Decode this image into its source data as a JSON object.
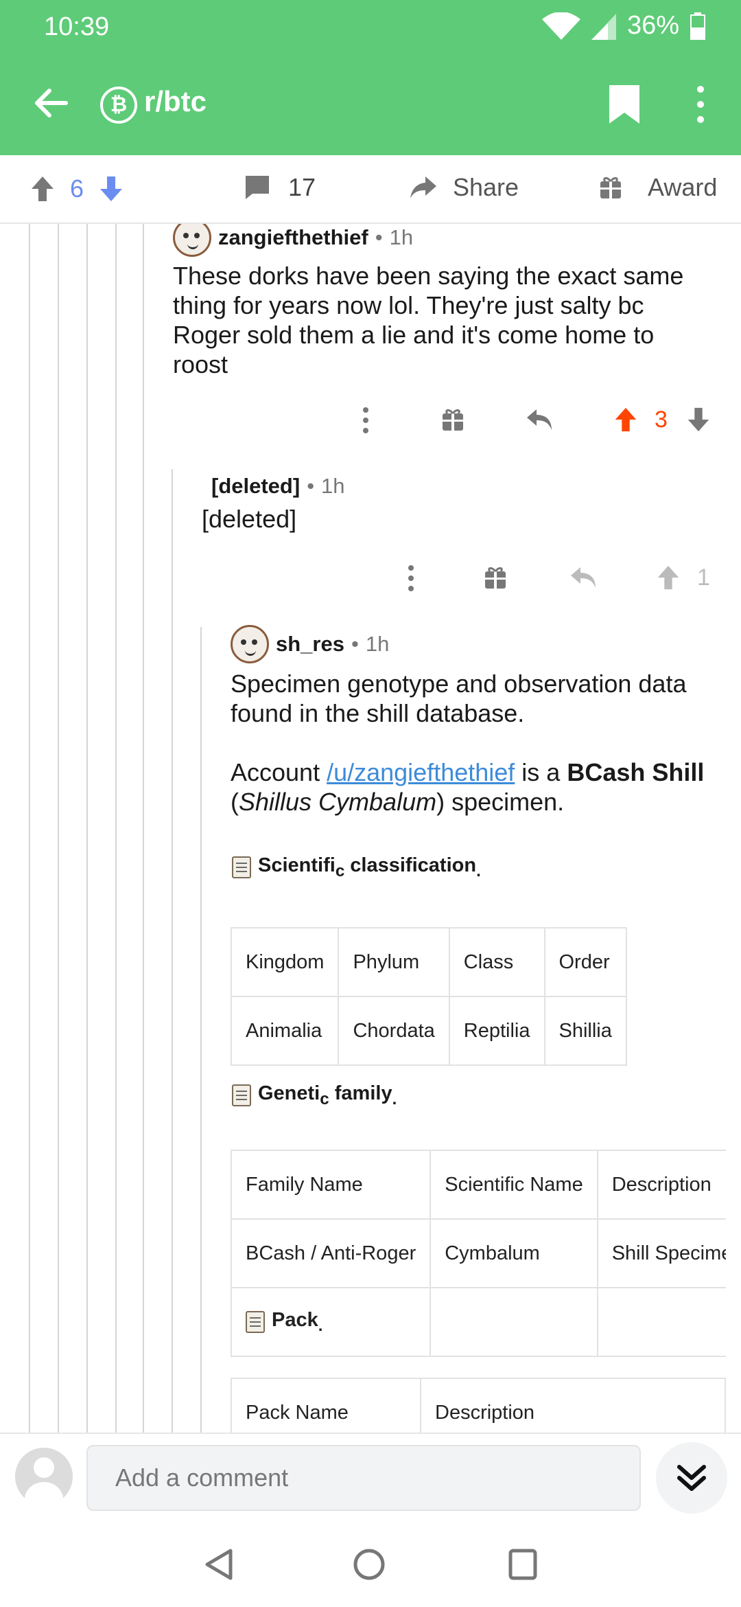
{
  "status_bar": {
    "time": "10:39",
    "battery": "36%"
  },
  "app_bar": {
    "subreddit": "r/btc"
  },
  "post_actions": {
    "vote_count": "6",
    "comment_count": "17",
    "share_label": "Share",
    "award_label": "Award"
  },
  "comments": [
    {
      "author": "zangiefthethief",
      "age": "1h",
      "lines": [
        "These dorks have been saying the exact same",
        "thing for years now lol. They're just salty bc",
        "Roger sold them a lie and it's come home to",
        "roost"
      ],
      "score": "3"
    },
    {
      "author": "[deleted]",
      "age": "1h",
      "body": "[deleted]",
      "score": "1"
    },
    {
      "author": "sh_res",
      "age": "1h",
      "line1": "Specimen genotype and observation data",
      "line2": "found in the shill database.",
      "account_prefix": "Account ",
      "account_link": "/u/zangiefthethief",
      "account_mid": " is a ",
      "account_bold": "BCash Shill",
      "species_open": "(",
      "species": "Shillus Cymbalum",
      "species_close": ") specimen.",
      "classification": {
        "title_a": "Scientifi",
        "title_b": "c",
        "title_c": " classificatio",
        "title_d": "n",
        "title_e": ".",
        "headers": [
          "Kingdom",
          "Phylum",
          "Class",
          "Order"
        ],
        "values": [
          "Animalia",
          "Chordata",
          "Reptilia",
          "Shillia"
        ]
      },
      "family": {
        "title_a": "Geneti",
        "title_b": "c",
        "title_c": " famil",
        "title_d": "y",
        "title_e": ".",
        "headers": [
          "Family Name",
          "Scientific Name",
          "Description"
        ],
        "values": [
          "BCash / Anti-Roger",
          "Cymbalum",
          "Shill Specime"
        ]
      },
      "pack": {
        "title": "Pack",
        "title_end": ".",
        "headers": [
          "Pack Name",
          "Description"
        ]
      }
    }
  ],
  "comment_bar": {
    "placeholder": "Add a comment"
  },
  "colors": {
    "accent": "#5ecb78",
    "upvote_active": "#ff4500",
    "link": "#3d8bd9",
    "downvote": "#6b8cf0"
  },
  "icons": [
    "back-arrow-icon",
    "bitcoin-icon",
    "bookmark-icon",
    "more-vert-icon",
    "upvote-icon",
    "downvote-icon",
    "comment-bubble-icon",
    "share-arrow-icon",
    "gift-icon",
    "reply-icon",
    "avatar-icon",
    "chevron-double-down-icon"
  ]
}
